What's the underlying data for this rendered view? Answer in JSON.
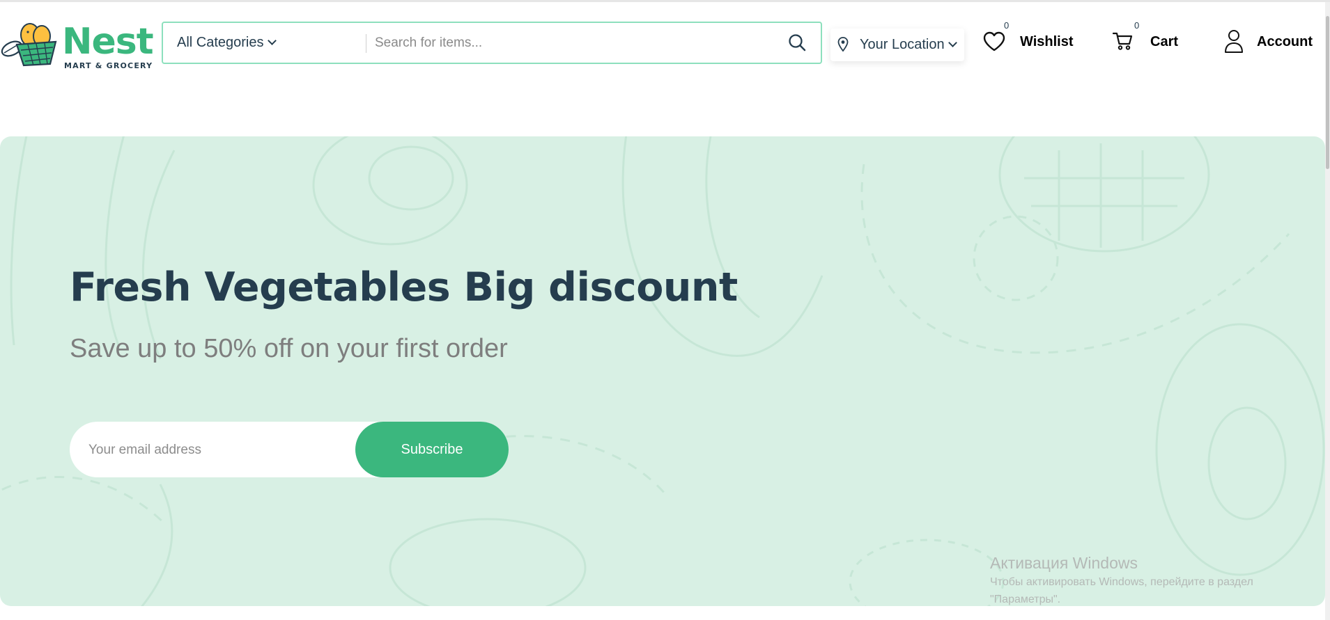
{
  "header": {
    "logo": {
      "name": "Nest",
      "tagline": "MART & GROCERY"
    },
    "search": {
      "category": "All Categories",
      "placeholder": "Search for items..."
    },
    "location": {
      "label": "Your Location"
    },
    "wishlist": {
      "label": "Wishlist",
      "count": "0"
    },
    "cart": {
      "label": "Cart",
      "count": "0"
    },
    "account": {
      "label": "Account"
    }
  },
  "hero": {
    "title": "Fresh Vegetables Big discount",
    "subtitle": "Save up to 50% off on your first order",
    "email_placeholder": "Your email address",
    "subscribe_label": "Subscribe"
  },
  "windows_watermark": {
    "title": "Активация Windows",
    "line1": "Чтобы активировать Windows, перейдите в раздел",
    "line2": "\"Параметры\"."
  },
  "colors": {
    "brand": "#3bb77e",
    "heading": "#253d4e",
    "hero_bg": "#d8f0e4",
    "muted": "#7e7e7e"
  }
}
